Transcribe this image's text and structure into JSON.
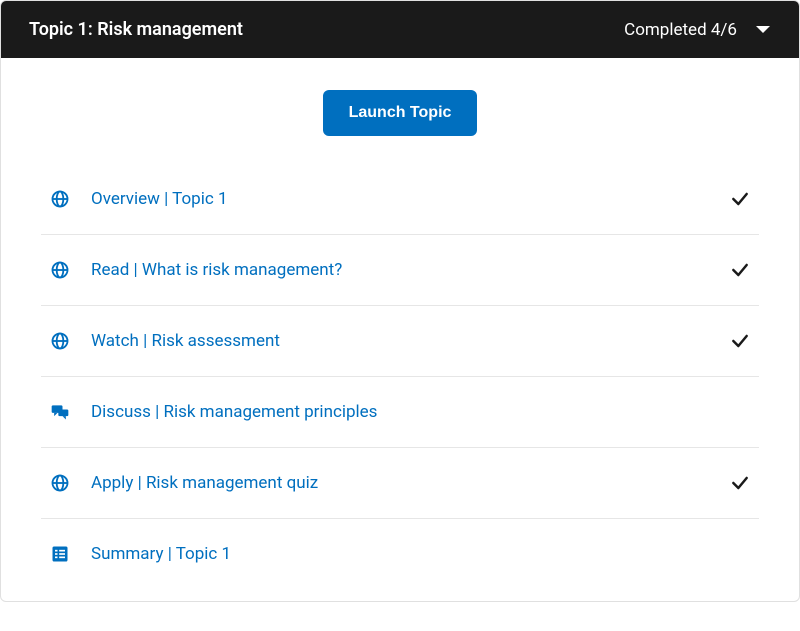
{
  "header": {
    "title": "Topic 1: Risk management",
    "status": "Completed 4/6"
  },
  "launch": {
    "label": "Launch Topic"
  },
  "items": [
    {
      "label": "Overview | Topic 1",
      "icon": "globe",
      "completed": true
    },
    {
      "label": "Read | What is risk management?",
      "icon": "globe",
      "completed": true
    },
    {
      "label": "Watch | Risk assessment",
      "icon": "globe",
      "completed": true
    },
    {
      "label": "Discuss | Risk management principles",
      "icon": "discuss",
      "completed": false
    },
    {
      "label": "Apply | Risk management quiz",
      "icon": "globe",
      "completed": true
    },
    {
      "label": "Summary | Topic 1",
      "icon": "summary",
      "completed": false
    }
  ],
  "colors": {
    "accent": "#006fbf",
    "header_bg": "#1a1a1a"
  }
}
